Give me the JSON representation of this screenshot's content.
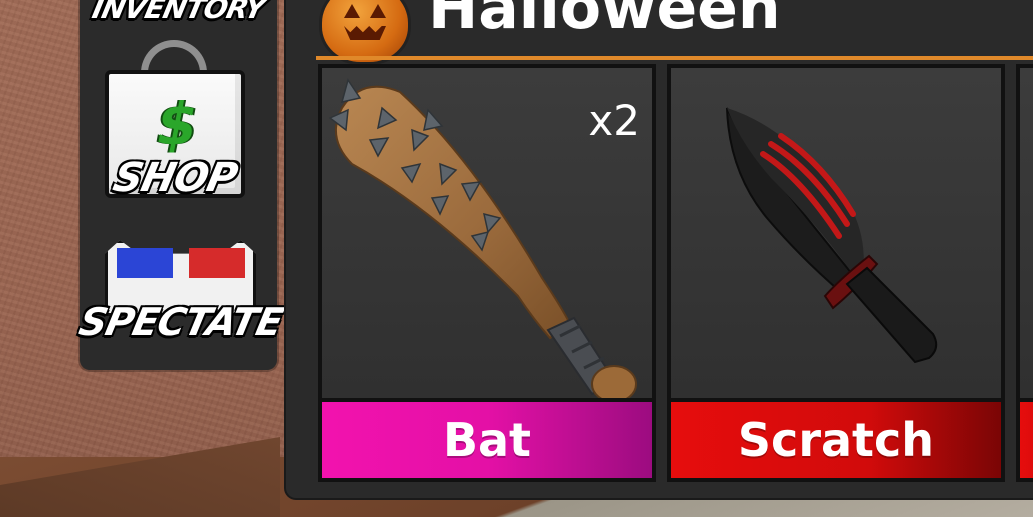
{
  "side_menu": {
    "inventory_label": "INVENTORY",
    "shop_label": "SHOP",
    "shop_symbol": "$",
    "spectate_label": "SPECTATE"
  },
  "panel": {
    "title": "Halloween",
    "icon": "pumpkin-icon",
    "accent_color": "#e0892a",
    "items": [
      {
        "name": "Bat",
        "count": "x2",
        "icon": "spiked-bat-icon",
        "bar_color": "#f212ae"
      },
      {
        "name": "Scratch",
        "count": "",
        "icon": "knife-icon",
        "bar_color": "#e60d0d"
      },
      {
        "name": "",
        "count": "",
        "icon": "",
        "bar_color": "#e60d0d"
      }
    ]
  }
}
